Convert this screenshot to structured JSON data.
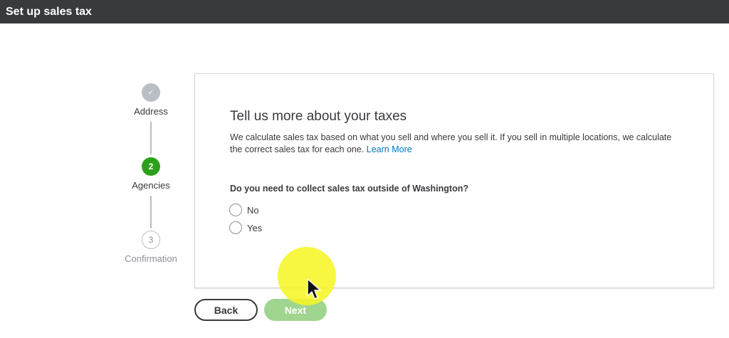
{
  "window": {
    "title": "Set up sales tax"
  },
  "stepper": {
    "steps": [
      {
        "label": "Address",
        "marker": "✓",
        "state": "complete"
      },
      {
        "label": "Agencies",
        "marker": "2",
        "state": "active"
      },
      {
        "label": "Confirmation",
        "marker": "3",
        "state": "upcoming"
      }
    ]
  },
  "card": {
    "heading": "Tell us more about your taxes",
    "description": "We calculate sales tax based on what you sell and where you sell it. If you sell in multiple locations, we calculate the correct sales tax for each one.",
    "learn_more": "Learn More",
    "question": "Do you need to collect sales tax outside of Washington?",
    "options": [
      {
        "label": "No",
        "selected": false
      },
      {
        "label": "Yes",
        "selected": false
      }
    ]
  },
  "buttons": {
    "back": "Back",
    "next": "Next"
  },
  "colors": {
    "titlebar": "#393a3d",
    "active_step": "#2ca01c",
    "complete_step": "#babec5",
    "link": "#0077c5",
    "next_disabled": "#9fd58f",
    "cursor_highlight": "#f6f628"
  },
  "icons": {
    "complete_step": "checkmark-icon",
    "cursor": "mouse-pointer-icon"
  }
}
